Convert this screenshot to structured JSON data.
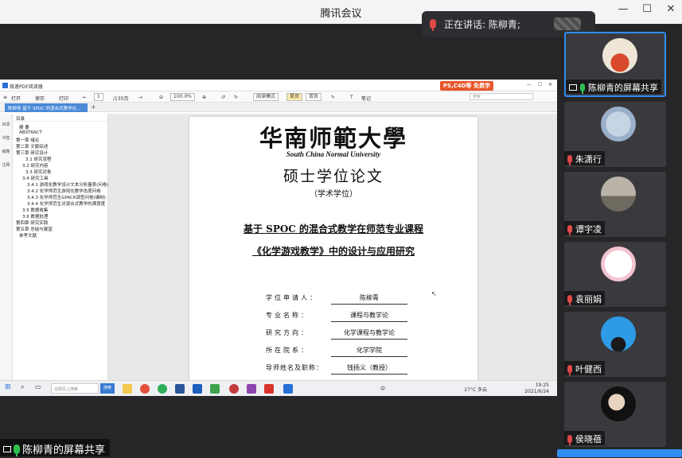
{
  "window": {
    "title": "腾讯会议",
    "controls": [
      "—",
      "☐",
      "✕"
    ]
  },
  "toast": {
    "text": "正在讲话: 陈柳青;"
  },
  "pdf": {
    "app_name": "极速PDF阅读器",
    "promo": "PS,C4D等 免费学",
    "toolbar": {
      "open": "打开",
      "save": "保存",
      "print": "打印",
      "page": "1",
      "total": "/135页",
      "zoom": "100.0%",
      "mode": "阅读模式",
      "single": "单页",
      "double": "双页",
      "annot": "笔记",
      "search_placeholder": "搜索"
    },
    "tab": "陈柳青 基于 SPOC 的混合式教学在...",
    "side": [
      "目录",
      "书签",
      "缩略",
      "注释"
    ],
    "outline_title": "目录",
    "outline": [
      "摘  要",
      "ABSTRACT",
      "第一章 绪论",
      "第二章 文献综述",
      "第三章 研究设计",
      "3.1 研究流程",
      "3.2 研究内容",
      "3.3 研究对象",
      "3.4 研究工具",
      "3.4.1 游戏化教学设计文本分析量表(问卷)",
      "3.4.2 化学师范生游戏化教学态度问卷",
      "3.4.3 化学师范生GPACK调查问卷(编制)",
      "3.4.4 化学师范生对混合式教学的满意度",
      "3.5 数据收集",
      "3.6 数据处理",
      "第四章 研究实践",
      "第五章 总结与展望",
      "参考文献"
    ],
    "page_content": {
      "university": "华南师範大學",
      "university_en": "South China Normal University",
      "degree": "硕士学位论文",
      "degree_type": "（学术学位）",
      "title_line1": "基于 SPOC 的混合式教学在师范专业课程",
      "title_line2": "《化学游戏教学》中的设计与应用研究",
      "info": [
        {
          "label": "学位申请人：",
          "value": "陈柳青"
        },
        {
          "label": "专业名称：",
          "value": "课程与教学论"
        },
        {
          "label": "研究方向：",
          "value": "化学课程与教学论"
        },
        {
          "label": "所在院系：",
          "value": "化学学院"
        },
        {
          "label": "导师姓名及职称：",
          "value": "钱扬义（教授）"
        }
      ]
    }
  },
  "taskbar": {
    "search_placeholder": "在网页上搜索",
    "search_button": "搜索",
    "weather": "27°C 多云",
    "time": "19:25",
    "date": "2021/6/24",
    "lang": "中"
  },
  "share_label": "陈柳青的屏幕共享",
  "participants": [
    {
      "name": "陈柳青的屏幕共享",
      "mic": "on",
      "sharing": true
    },
    {
      "name": "朱潇行",
      "mic": "off"
    },
    {
      "name": "谭宇凌",
      "mic": "off"
    },
    {
      "name": "袁丽娟",
      "mic": "off"
    },
    {
      "name": "叶健西",
      "mic": "off"
    },
    {
      "name": "侯晓蓓",
      "mic": "off"
    }
  ],
  "colors": {
    "accent": "#2f8cf0",
    "mic_on": "#2fbf4f",
    "mic_off": "#e04848"
  }
}
